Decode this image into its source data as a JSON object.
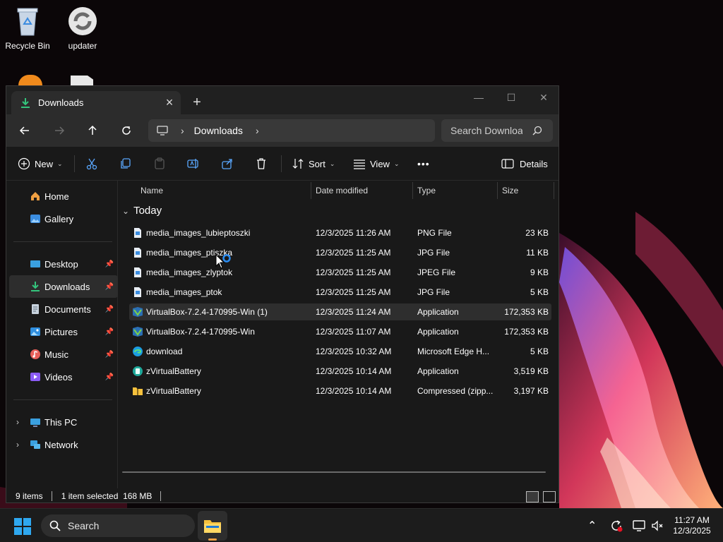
{
  "desktop": {
    "icons": [
      {
        "label": "Recycle Bin",
        "icon": "recycle-bin-icon"
      },
      {
        "label": "updater",
        "icon": "updater-icon"
      }
    ]
  },
  "window": {
    "tab_title": "Downloads",
    "tab_icon": "download-icon",
    "new_tab": "+",
    "controls": {
      "minimize": "—",
      "maximize": "☐",
      "close": "✕"
    }
  },
  "nav": {
    "breadcrumb": [
      "Downloads"
    ],
    "search_placeholder": "Search Downloa"
  },
  "commandbar": {
    "new_label": "New",
    "sort_label": "Sort",
    "view_label": "View",
    "more_label": "•••",
    "details_label": "Details"
  },
  "sidebar": {
    "home": "Home",
    "gallery": "Gallery",
    "pinned": [
      {
        "label": "Desktop",
        "icon": "desktop-icon"
      },
      {
        "label": "Downloads",
        "icon": "download-icon"
      },
      {
        "label": "Documents",
        "icon": "documents-icon"
      },
      {
        "label": "Pictures",
        "icon": "pictures-icon"
      },
      {
        "label": "Music",
        "icon": "music-icon"
      },
      {
        "label": "Videos",
        "icon": "videos-icon"
      }
    ],
    "this_pc": "This PC",
    "network": "Network"
  },
  "columns": {
    "name": "Name",
    "date": "Date modified",
    "type": "Type",
    "size": "Size"
  },
  "group": "Today",
  "files": [
    {
      "name": "media_images_lubieptoszki",
      "date": "12/3/2025 11:26 AM",
      "type": "PNG File",
      "size": "23 KB",
      "icon": "image-file-icon"
    },
    {
      "name": "media_images_ptiszka",
      "date": "12/3/2025 11:25 AM",
      "type": "JPG File",
      "size": "11 KB",
      "icon": "image-file-icon"
    },
    {
      "name": "media_images_zlyptok",
      "date": "12/3/2025 11:25 AM",
      "type": "JPEG File",
      "size": "9 KB",
      "icon": "image-file-icon"
    },
    {
      "name": "media_images_ptok",
      "date": "12/3/2025 11:25 AM",
      "type": "JPG File",
      "size": "5 KB",
      "icon": "image-file-icon"
    },
    {
      "name": "VirtualBox-7.2.4-170995-Win (1)",
      "date": "12/3/2025 11:24 AM",
      "type": "Application",
      "size": "172,353 KB",
      "icon": "virtualbox-icon"
    },
    {
      "name": "VirtualBox-7.2.4-170995-Win",
      "date": "12/3/2025 11:07 AM",
      "type": "Application",
      "size": "172,353 KB",
      "icon": "virtualbox-icon"
    },
    {
      "name": "download",
      "date": "12/3/2025 10:32 AM",
      "type": "Microsoft Edge H...",
      "size": "5 KB",
      "icon": "edge-icon"
    },
    {
      "name": "zVirtualBattery",
      "date": "12/3/2025 10:14 AM",
      "type": "Application",
      "size": "3,519 KB",
      "icon": "battery-app-icon"
    },
    {
      "name": "zVirtualBattery",
      "date": "12/3/2025 10:14 AM",
      "type": "Compressed (zipp...",
      "size": "3,197 KB",
      "icon": "zip-folder-icon"
    }
  ],
  "selected_index": 4,
  "status": {
    "count": "9 items",
    "selection": "1 item selected  168 MB"
  },
  "taskbar": {
    "search_label": "Search",
    "time": "11:27 AM",
    "date": "12/3/2025"
  },
  "colors": {
    "accent": "#4cc2ff",
    "window_bg": "#191919",
    "selected_row": "#2e2e2e",
    "folder_yellow": "#f6c13d"
  }
}
